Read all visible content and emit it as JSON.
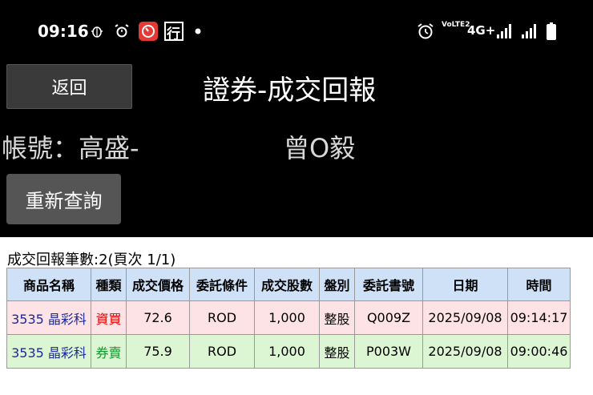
{
  "status_bar": {
    "time": "09:16",
    "network": "4G+",
    "volte": "VoLTE2",
    "icons": [
      "bug-icon",
      "alarm-icon",
      "red-clock-app-icon",
      "bank-app-icon",
      "dot-icon",
      "alarm-icon",
      "signal-icon",
      "signal-icon",
      "battery-icon"
    ],
    "app_icon_text": "行"
  },
  "header": {
    "back_label": "返回",
    "title": "證券-成交回報"
  },
  "account": {
    "label": "帳號：高盛-",
    "name": "曾O毅"
  },
  "requery_label": "重新查詢",
  "report": {
    "summary": "成交回報筆數:2(頁次 1/1)",
    "columns": [
      "商品名稱",
      "種類",
      "成交價格",
      "委託條件",
      "成交股數",
      "盤別",
      "委託書號",
      "日期",
      "時間"
    ],
    "rows": [
      {
        "product": "3535 晶彩科",
        "type": "資買",
        "price": "72.6",
        "condition": "ROD",
        "shares": "1,000",
        "session": "整股",
        "order_no": "Q009Z",
        "date": "2025/09/08",
        "time": "09:14:17"
      },
      {
        "product": "3535 晶彩科",
        "type": "券賣",
        "price": "75.9",
        "condition": "ROD",
        "shares": "1,000",
        "session": "整股",
        "order_no": "P003W",
        "date": "2025/09/08",
        "time": "09:00:46"
      }
    ]
  },
  "colors": {
    "header_bg": "#cfe1f7",
    "buy_row_bg": "#fde3e5",
    "sell_row_bg": "#dcf6d3",
    "buy_text": "#e00000",
    "sell_text": "#0a9c2a",
    "product_text": "#1a2a9c"
  }
}
